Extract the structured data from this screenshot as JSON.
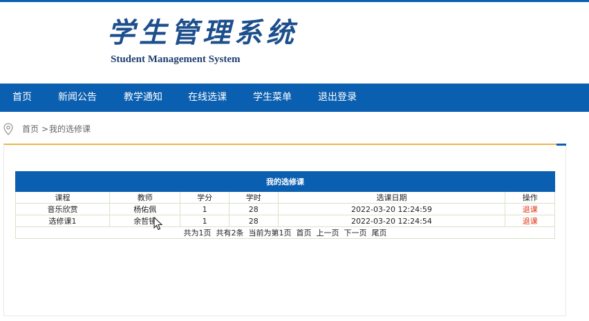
{
  "logo": {
    "title_cn": "学生管理系统",
    "title_en": "Student Management System"
  },
  "nav": [
    "首页",
    "新闻公告",
    "教学通知",
    "在线选课",
    "学生菜单",
    "退出登录"
  ],
  "breadcrumb": {
    "home": "首页",
    "sep": ">",
    "current": "我的选修课"
  },
  "table": {
    "caption": "我的选修课",
    "headers": [
      "课程",
      "教师",
      "学分",
      "学时",
      "选课日期",
      "操作"
    ],
    "rows": [
      [
        "音乐欣赏",
        "杨佑佩",
        "1",
        "28",
        "2022-03-20 12:24:59",
        "退课"
      ],
      [
        "选修课1",
        "余哲镜",
        "1",
        "28",
        "2022-03-20 12:24:54",
        "退课"
      ]
    ]
  },
  "pager": {
    "total_pages": "共为1页",
    "total_items": "共有2条",
    "current": "当前为第1页",
    "first": "首页",
    "prev": "上一页",
    "next": "下一页",
    "last": "尾页"
  },
  "colors": {
    "brand": "#0b5fb0",
    "accent_line": "#f0b24a",
    "action": "#e0371a"
  },
  "icons": {
    "breadcrumb": "location-pin-icon",
    "pointer": "mouse-cursor-icon"
  }
}
